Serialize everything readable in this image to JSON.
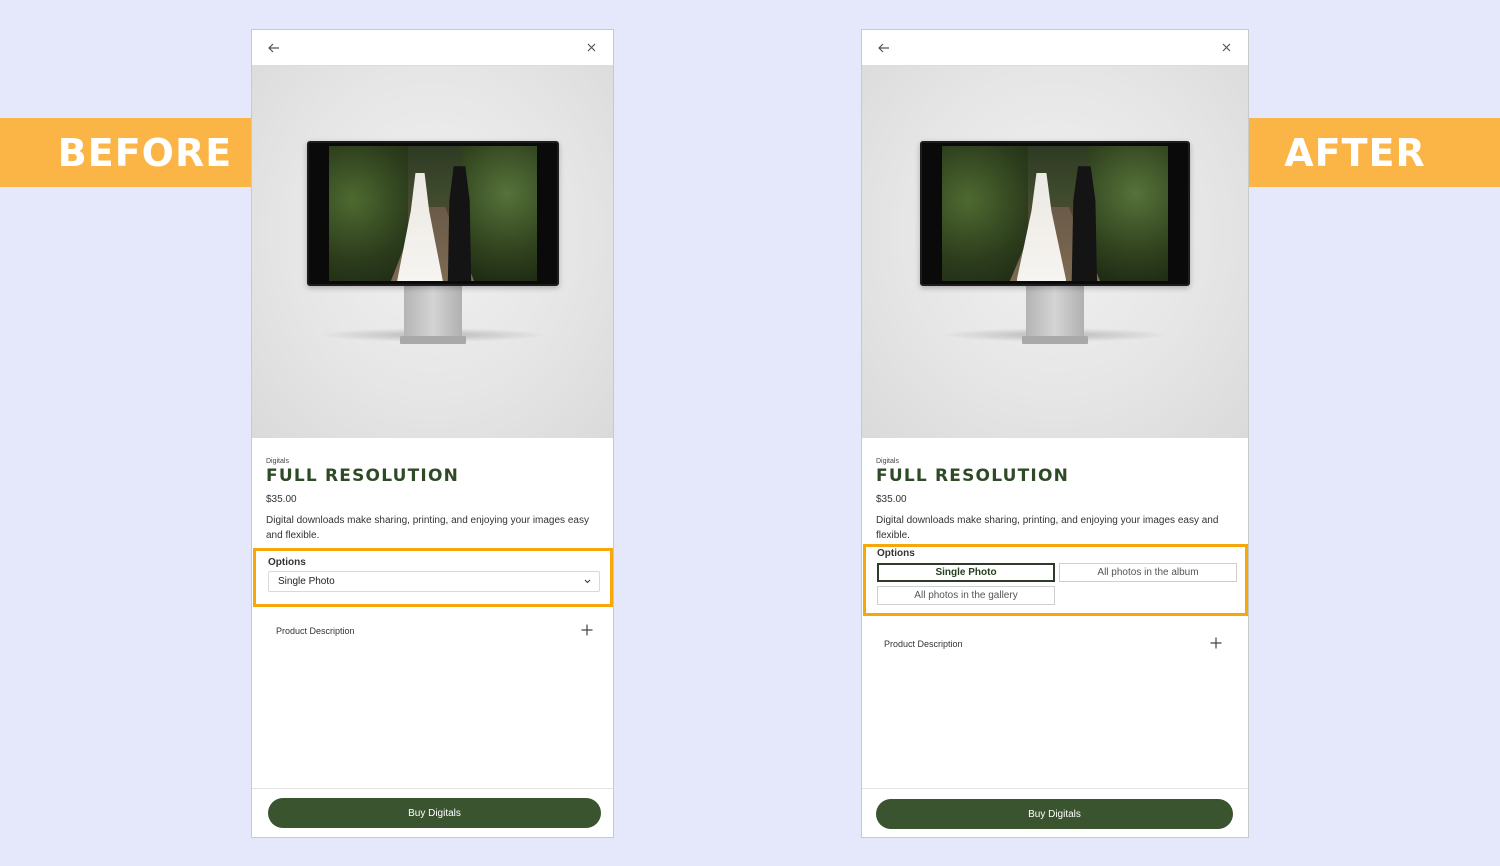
{
  "labels": {
    "before": "BEFORE",
    "after": "AFTER"
  },
  "before": {
    "category": "Digitals",
    "title": "FULL RESOLUTION",
    "price": "$35.00",
    "description": "Digital downloads make sharing, printing, and enjoying your images easy and flexible.",
    "options_label": "Options",
    "select_value": "Single Photo",
    "product_description": "Product Description",
    "buy_label": "Buy Digitals"
  },
  "after": {
    "category": "Digitals",
    "title": "FULL RESOLUTION",
    "price": "$35.00",
    "description": "Digital downloads make sharing, printing, and enjoying your images easy and flexible.",
    "options_label": "Options",
    "options": [
      {
        "label": "Single Photo",
        "selected": true
      },
      {
        "label": "All photos in the album",
        "selected": false
      },
      {
        "label": "All photos in the gallery",
        "selected": false
      }
    ],
    "product_description": "Product Description",
    "buy_label": "Buy Digitals"
  },
  "colors": {
    "background": "#e4e8fa",
    "banner": "#fbb546",
    "highlight": "#f7a70a",
    "brand_green": "#3a5430",
    "title_green": "#2e4a26"
  },
  "icons": {
    "back": "arrow-left-icon",
    "close": "close-icon",
    "dropdown": "chevron-down-icon",
    "expand": "plus-icon"
  }
}
